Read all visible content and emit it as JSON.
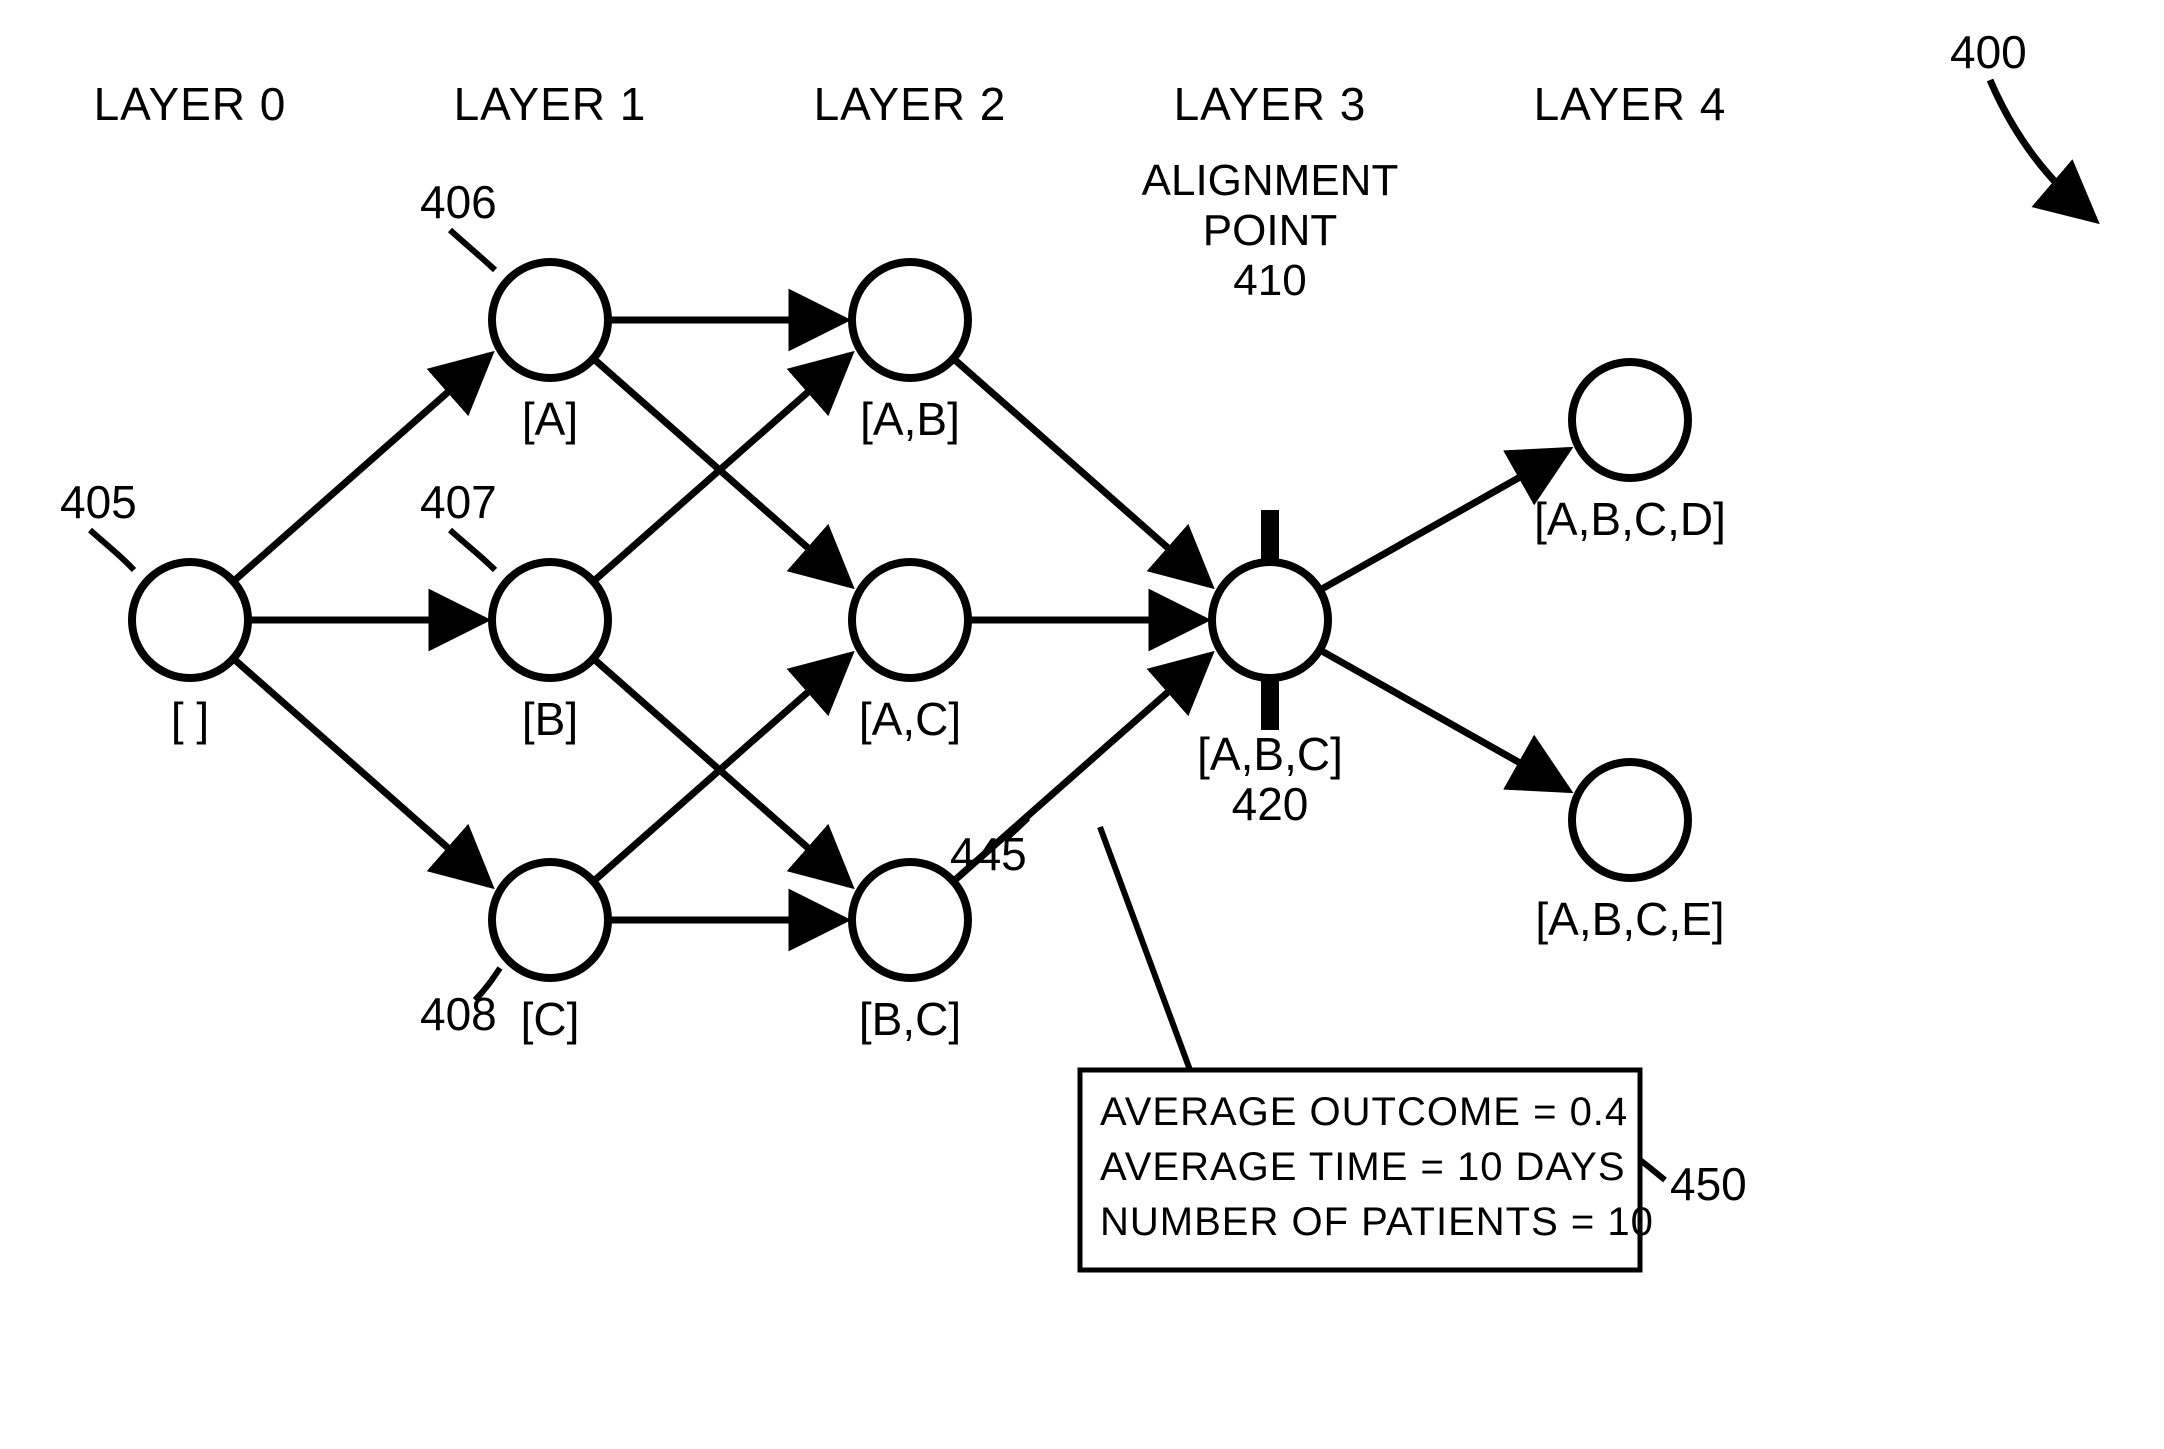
{
  "diagram_ref": "400",
  "layers": {
    "l0": "LAYER 0",
    "l1": "LAYER 1",
    "l2": "LAYER 2",
    "l3": "LAYER 3",
    "l4": "LAYER 4"
  },
  "alignment": {
    "line1": "ALIGNMENT",
    "line2": "POINT",
    "ref": "410"
  },
  "nodes": {
    "root": {
      "set": "[ ]",
      "ref": "405"
    },
    "a": {
      "set": "[A]",
      "ref": "406"
    },
    "b": {
      "set": "[B]",
      "ref": "407"
    },
    "c": {
      "set": "[C]",
      "ref": "408"
    },
    "ab": {
      "set": "[A,B]"
    },
    "ac": {
      "set": "[A,C]"
    },
    "bc": {
      "set": "[B,C]"
    },
    "abc": {
      "set": "[A,B,C]",
      "ref": "420"
    },
    "abcd": {
      "set": "[A,B,C,D]"
    },
    "abce": {
      "set": "[A,B,C,E]"
    }
  },
  "edge_ref": "445",
  "info_box": {
    "line1": "AVERAGE OUTCOME = 0.4",
    "line2": "AVERAGE TIME = 10 DAYS",
    "line3": "NUMBER OF PATIENTS = 10",
    "ref": "450"
  }
}
